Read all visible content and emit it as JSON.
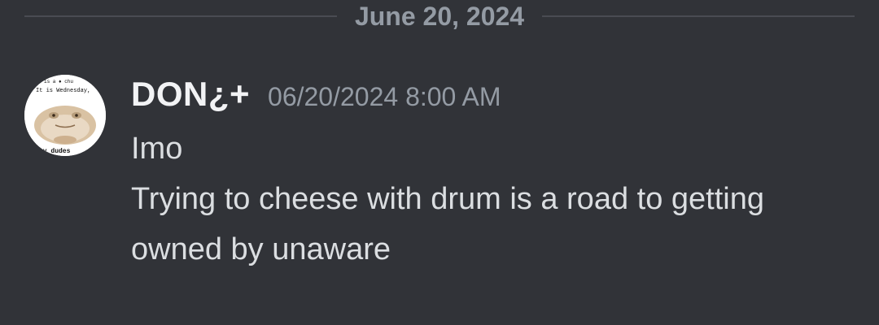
{
  "divider": {
    "date": "June 20, 2024"
  },
  "message": {
    "username": "DON¿+",
    "timestamp": "06/20/2024 8:00 AM",
    "lines": [
      "Imo",
      "Trying to cheese with drum is a road to getting",
      "owned by unaware"
    ],
    "avatar": {
      "icon": "frog-avatar-icon",
      "caption_top": "It is Wednesday,",
      "caption_bottom": "my dudes"
    }
  },
  "colors": {
    "background": "#313338",
    "username": "#f2f3f5",
    "muted": "#949ba4",
    "text": "#dbdee1",
    "divider": "#4a4c53"
  }
}
